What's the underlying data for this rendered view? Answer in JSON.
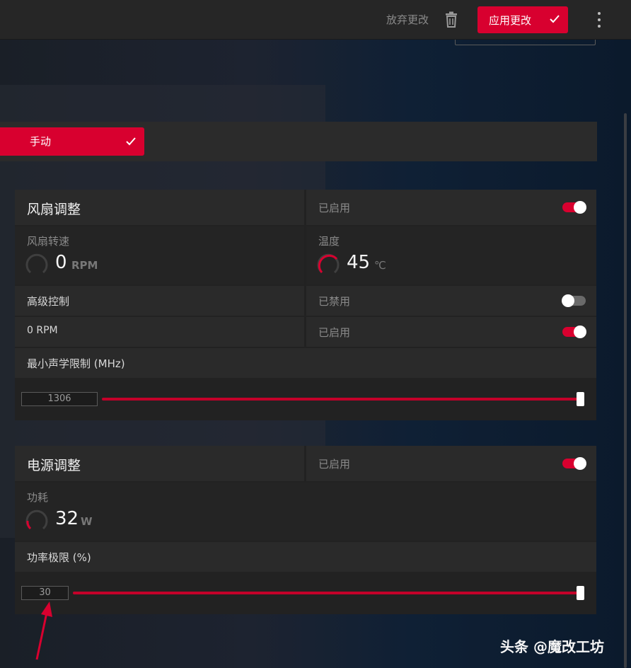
{
  "topbar": {
    "discard_label": "放弃更改",
    "apply_label": "应用更改"
  },
  "mode": {
    "selected": "手动"
  },
  "fan_tuning": {
    "title": "风扇调整",
    "status": "已启用",
    "enabled": true,
    "fan_speed_label": "风扇转速",
    "fan_speed_value": "0",
    "fan_speed_unit": "RPM",
    "fan_speed_fraction": 0,
    "temp_label": "温度",
    "temp_value": "45",
    "temp_unit": "℃",
    "temp_fraction": 0.45,
    "advanced_label": "高级控制",
    "advanced_status": "已禁用",
    "advanced_enabled": false,
    "zero_rpm_label": "0 RPM",
    "zero_rpm_status": "已启用",
    "zero_rpm_enabled": true,
    "min_acoustic_label": "最小声学限制 (MHz)",
    "min_acoustic_value": "1306",
    "min_acoustic_fraction": 1.0
  },
  "power_tuning": {
    "title": "电源调整",
    "status": "已启用",
    "enabled": true,
    "power_label": "功耗",
    "power_value": "32",
    "power_unit": "W",
    "power_fraction": 0.2,
    "limit_label": "功率极限 (%)",
    "limit_value": "30",
    "limit_fraction": 1.0
  },
  "watermark": "头条 @魔改工坊",
  "colors": {
    "accent": "#d8002f",
    "panel": "#2a2a2a",
    "topbar": "#262626"
  },
  "icons": [
    "trash-icon",
    "check-icon",
    "more-vertical-icon",
    "gauge-icon",
    "arrow-icon"
  ]
}
